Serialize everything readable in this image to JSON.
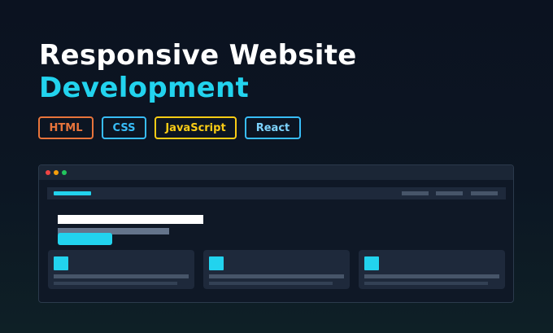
{
  "headline": {
    "line1": "Responsive Website",
    "line2": "Development"
  },
  "tags": [
    {
      "label": "HTML",
      "color": "#e8743b"
    },
    {
      "label": "CSS",
      "color": "#38bdf8"
    },
    {
      "label": "JavaScript",
      "color": "#facc15"
    },
    {
      "label": "React",
      "color": "#38bdf8"
    }
  ],
  "colors": {
    "accent": "#22d3ee",
    "background": "#0b1220",
    "window_dots": [
      "#ef4444",
      "#f59e0b",
      "#22c55e"
    ]
  },
  "mock_browser": {
    "nav_link_count": 3,
    "card_count": 3
  }
}
